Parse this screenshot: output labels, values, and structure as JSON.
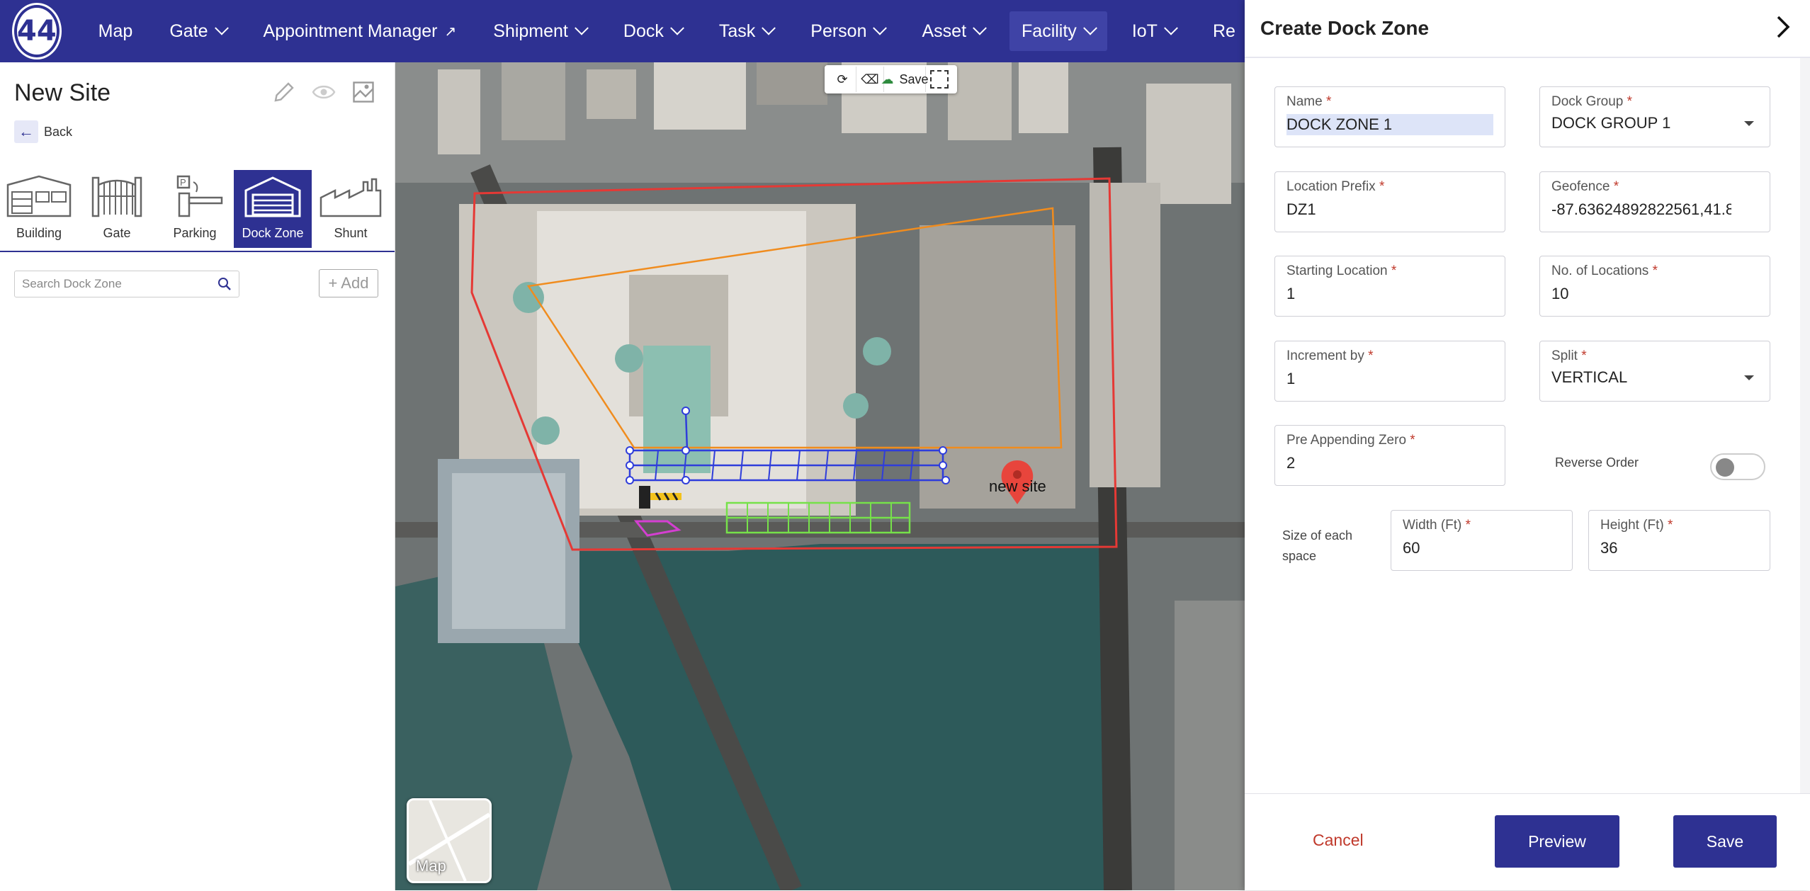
{
  "nav": {
    "logo": "44",
    "items": [
      {
        "label": "Map",
        "chevron": false
      },
      {
        "label": "Gate",
        "chevron": true
      },
      {
        "label": "Appointment Manager",
        "chevron": false,
        "external": true
      },
      {
        "label": "Shipment",
        "chevron": true
      },
      {
        "label": "Dock",
        "chevron": true
      },
      {
        "label": "Task",
        "chevron": true
      },
      {
        "label": "Person",
        "chevron": true
      },
      {
        "label": "Asset",
        "chevron": true
      },
      {
        "label": "Facility",
        "chevron": true,
        "active": true
      },
      {
        "label": "IoT",
        "chevron": true
      },
      {
        "label": "Re",
        "chevron": false
      }
    ],
    "external_icon": "external-link-icon"
  },
  "left_panel": {
    "site_title": "New Site",
    "back_label": "Back",
    "types": [
      {
        "label": "Building",
        "icon": "building-icon"
      },
      {
        "label": "Gate",
        "icon": "gate-icon"
      },
      {
        "label": "Parking",
        "icon": "parking-icon"
      },
      {
        "label": "Dock Zone",
        "icon": "dock-zone-icon",
        "active": true
      },
      {
        "label": "Shunt",
        "icon": "shunt-icon"
      }
    ],
    "search_placeholder": "Search Dock Zone",
    "add_label": "+ Add"
  },
  "map": {
    "toolbar_save": "Save",
    "pin_label": "new site",
    "map_toggle_label": "Map"
  },
  "dialog": {
    "title": "Create Dock Zone",
    "fields": {
      "name": {
        "label": "Name",
        "value": "DOCK ZONE 1"
      },
      "dock_group": {
        "label": "Dock Group",
        "value": "DOCK GROUP 1"
      },
      "location_prefix": {
        "label": "Location Prefix",
        "value": "DZ1"
      },
      "geofence": {
        "label": "Geofence",
        "value": "-87.63624892822561,41.8"
      },
      "starting_location": {
        "label": "Starting Location",
        "value": "1"
      },
      "no_of_locations": {
        "label": "No. of Locations",
        "value": "10"
      },
      "increment_by": {
        "label": "Increment by",
        "value": "1"
      },
      "split": {
        "label": "Split",
        "value": "VERTICAL"
      },
      "pre_appending_zero": {
        "label": "Pre Appending Zero",
        "value": "2"
      },
      "width": {
        "label": "Width (Ft)",
        "value": "60"
      },
      "height": {
        "label": "Height (Ft)",
        "value": "36"
      }
    },
    "required_mark": "*",
    "reverse_order_label": "Reverse Order",
    "reverse_order_on": false,
    "size_label": "Size of each space",
    "cancel_label": "Cancel",
    "preview_label": "Preview",
    "save_label": "Save"
  },
  "colors": {
    "brand": "#2e3192",
    "danger": "#c0392b",
    "site_outline": "#e53935",
    "building_outline": "#f08c1e",
    "dock_zone": "#2f3ddb",
    "parking": "#76e14a",
    "gate": "#d43fd1"
  }
}
